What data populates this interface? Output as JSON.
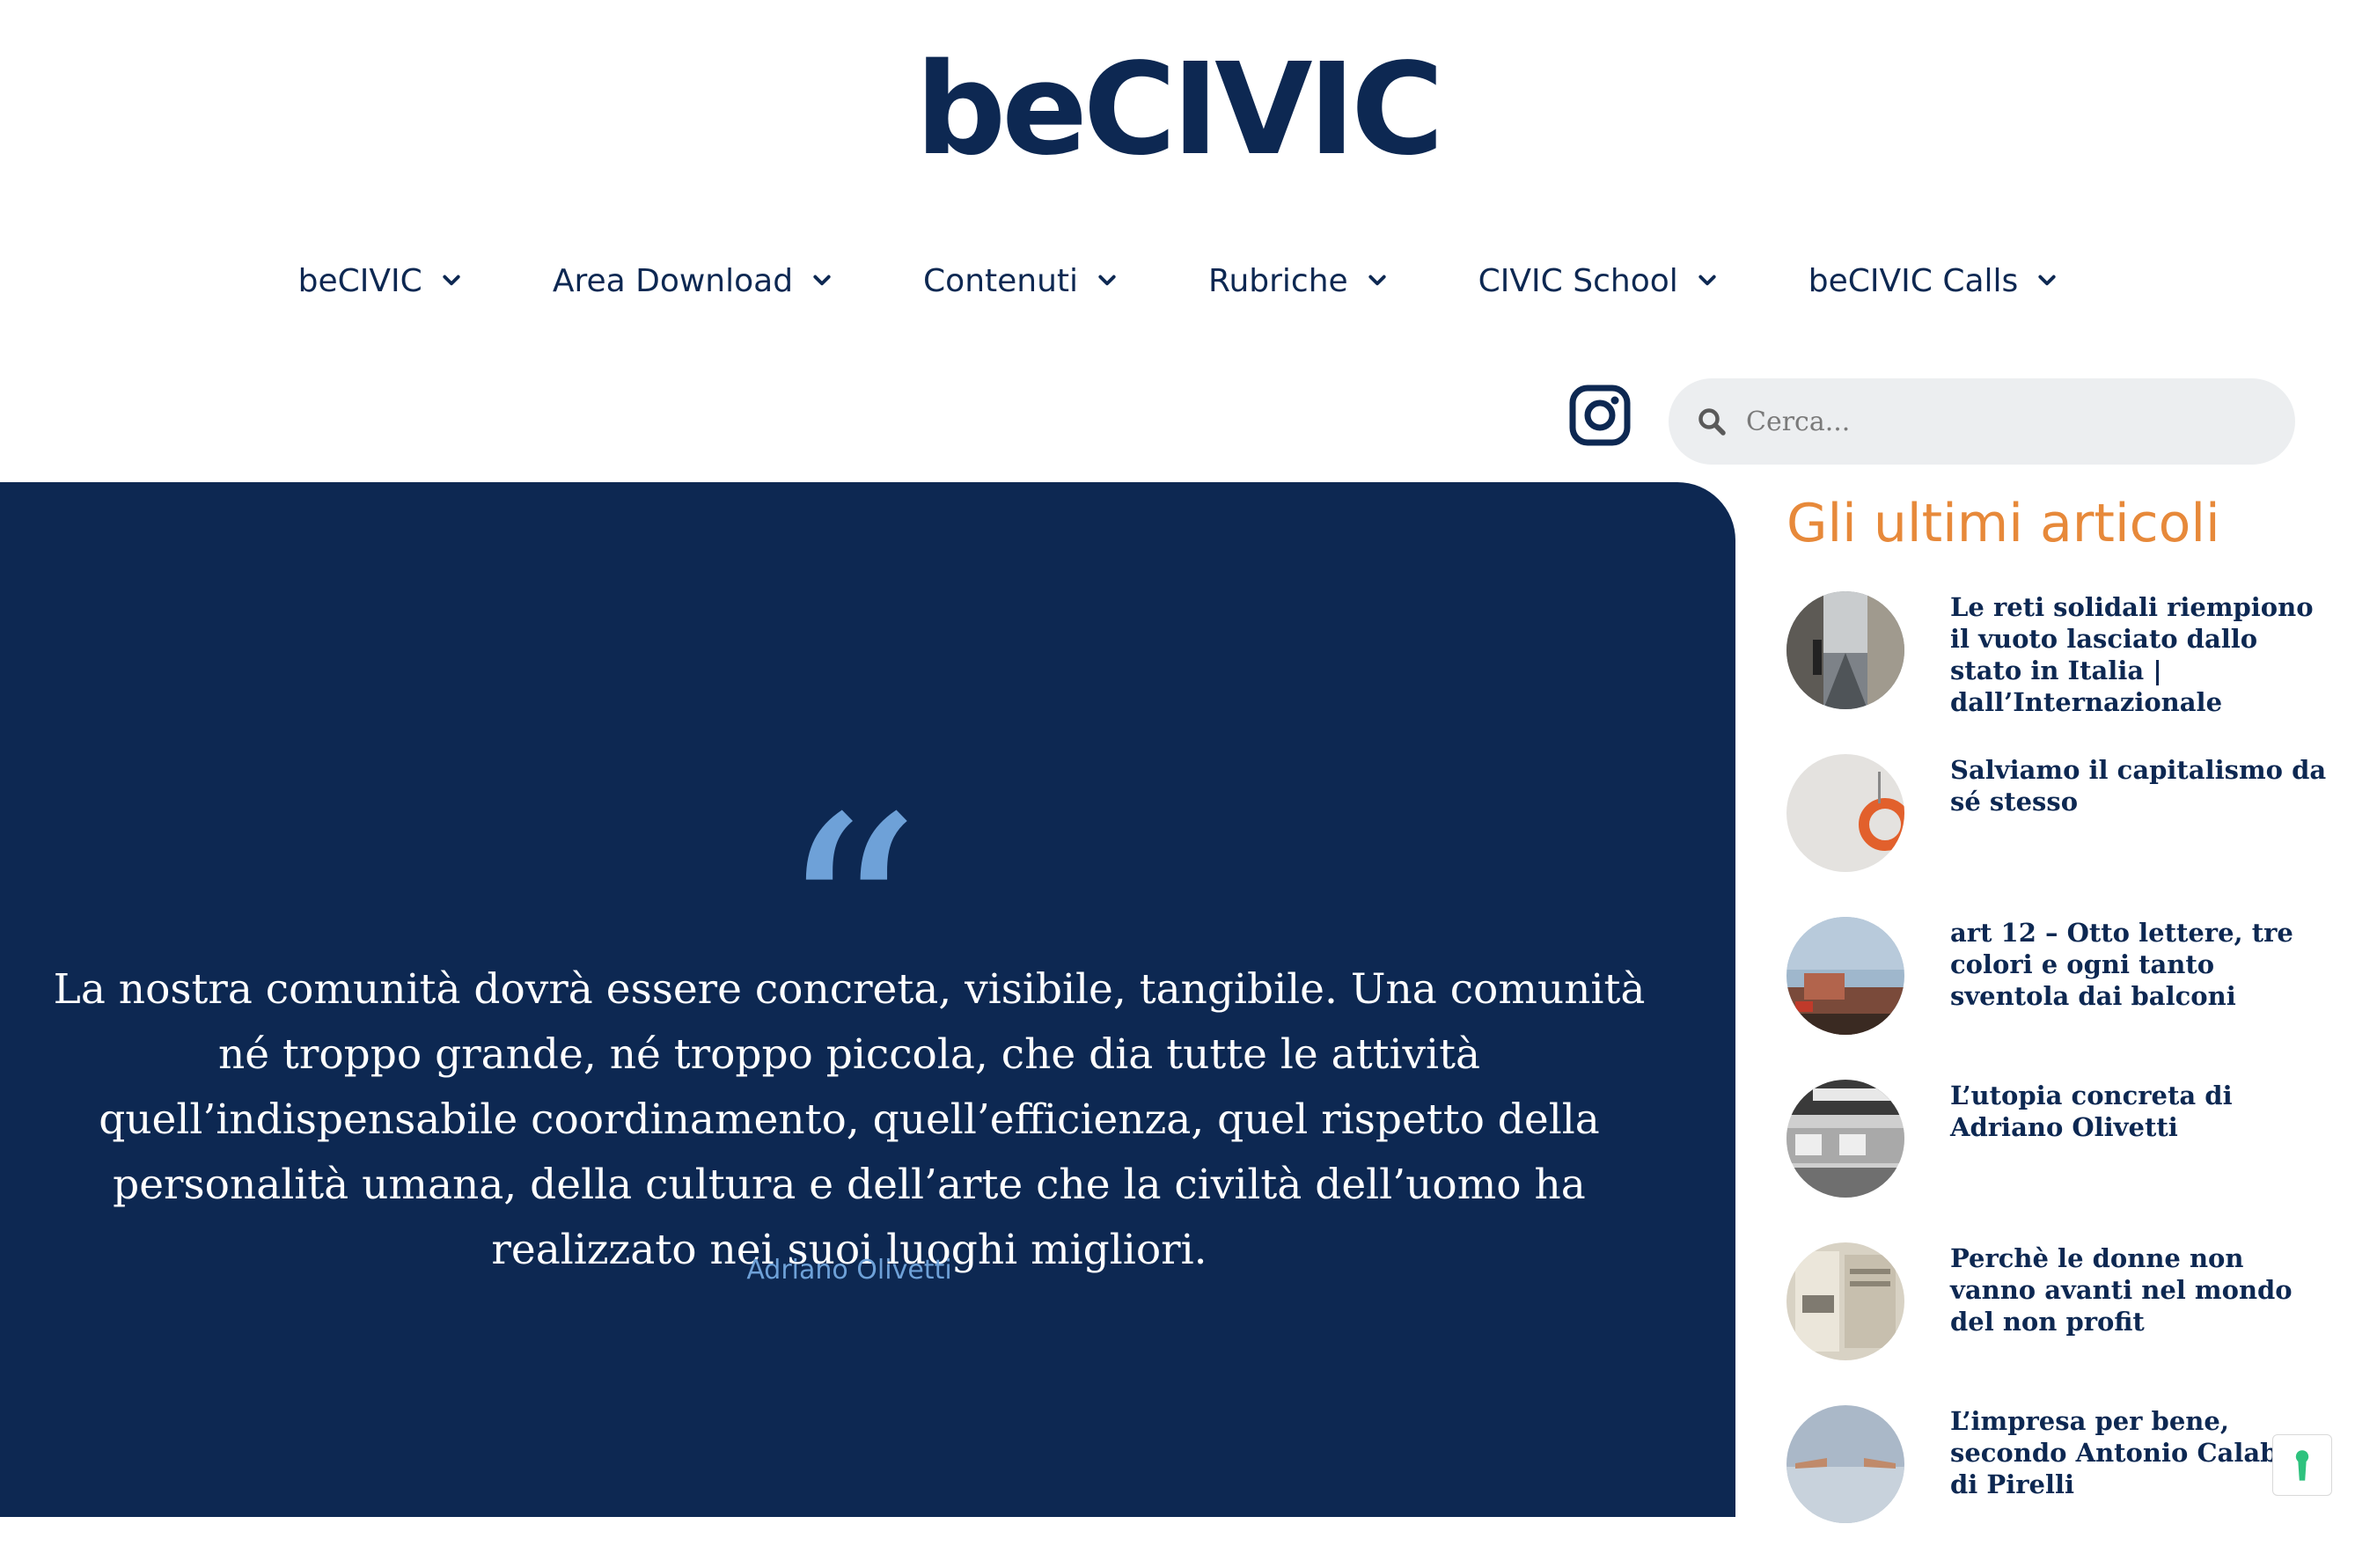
{
  "brand": {
    "logo_text": "beCIVIC"
  },
  "nav": {
    "items": [
      {
        "label": "beCIVIC"
      },
      {
        "label": "Area Download"
      },
      {
        "label": "Contenuti"
      },
      {
        "label": "Rubriche"
      },
      {
        "label": "CIVIC School"
      },
      {
        "label": "beCIVIC Calls"
      }
    ]
  },
  "header": {
    "search_placeholder": "Cerca...",
    "icons": {
      "social": "instagram-icon",
      "search": "search-icon"
    }
  },
  "quote": {
    "mark": "“",
    "text": "La nostra comunità dovrà essere concreta, visibile, tangibile. Una comunità né troppo grande, né troppo piccola, che dia tutte le attività quell’indispensabile coordinamento, quell’efficienza, quel rispetto della personalità umana, della cultura e dell’arte che la civiltà dell’uomo ha realizzato nei suoi luoghi migliori.",
    "author": "Adriano Olivetti"
  },
  "sidebar": {
    "title": "Gli ultimi articoli",
    "articles": [
      {
        "title": "Le reti solidali riempiono il vuoto lasciato dallo stato in Italia | dall’Internazionale"
      },
      {
        "title": "Salviamo il capitalismo da sé stesso"
      },
      {
        "title": "art 12 – Otto lettere, tre colori e ogni tanto sventola dai balconi"
      },
      {
        "title": "L’utopia concreta di Adriano Olivetti"
      },
      {
        "title": "Perchè le donne non vanno avanti nel mondo del non profit"
      },
      {
        "title": "L’impresa per bene, secondo Antonio Calabrò di Pirelli"
      }
    ]
  },
  "colors": {
    "navy": "#0d2852",
    "quote_accent": "#6ea1d8",
    "sidebar_title": "#e7893a",
    "search_bg": "#eceef0"
  }
}
